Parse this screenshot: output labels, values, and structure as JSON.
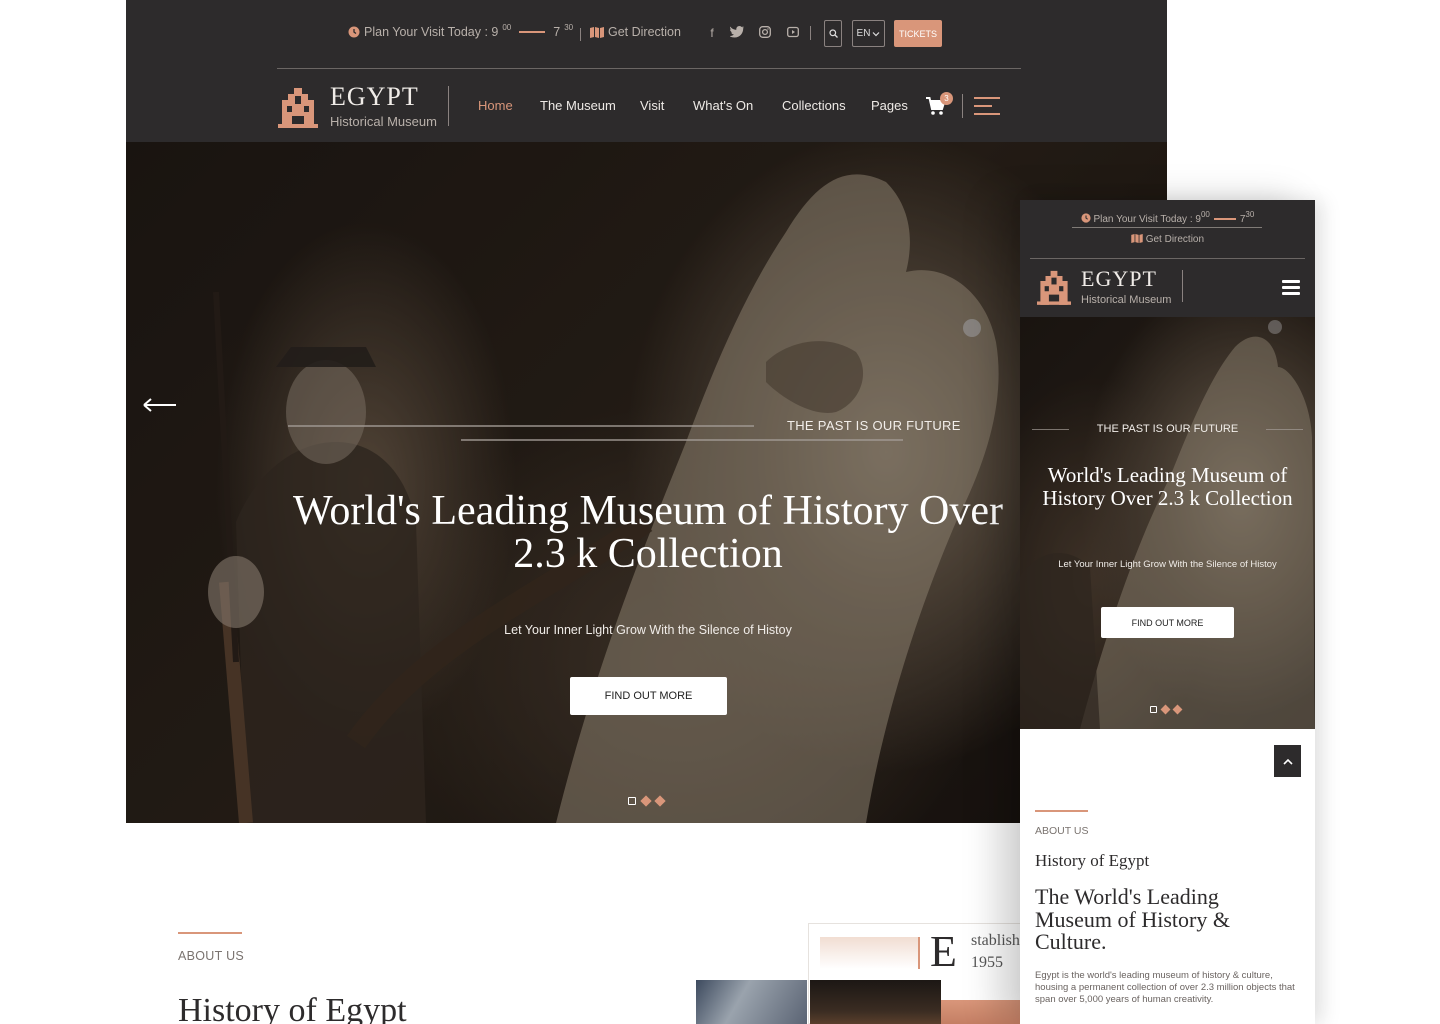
{
  "colors": {
    "accent": "#d9967a",
    "header_bg": "#2d2b2c",
    "white": "#ffffff"
  },
  "desktop": {
    "topbar": {
      "visit_label": "Plan Your Visit Today : 9",
      "open_sup": "00",
      "close_hour": "7",
      "close_sup": "30",
      "direction_label": "Get Direction",
      "social_icons": [
        "facebook-icon",
        "twitter-icon",
        "instagram-icon",
        "youtube-icon"
      ],
      "language": "EN",
      "tickets_label": "TICKETS"
    },
    "logo": {
      "title": "EGYPT",
      "subtitle": "Historical Museum"
    },
    "nav": {
      "items": [
        "Home",
        "The Museum",
        "Visit",
        "What's On",
        "Collections",
        "Pages"
      ],
      "active_index": 0,
      "cart_count": "3"
    },
    "hero": {
      "kicker": "THE PAST IS OUR FUTURE",
      "title": "World's Leading Museum of History Over 2.3 k Collection",
      "subtitle": "Let Your Inner Light Grow With the Silence of Histoy",
      "button": "FIND OUT MORE",
      "slide_count": 3,
      "active_slide": 1
    },
    "about": {
      "label": "ABOUT US",
      "title": "History of Egypt",
      "est_initial": "E",
      "est_line1": "stablish",
      "est_line2": "1955"
    }
  },
  "mobile": {
    "topbar": {
      "visit_label": "Plan Your Visit Today : 9",
      "open_sup": "00",
      "close_hour": "7",
      "close_sup": "30",
      "direction_label": "Get Direction"
    },
    "logo": {
      "title": "EGYPT",
      "subtitle": "Historical Museum"
    },
    "hero": {
      "kicker": "THE PAST IS OUR FUTURE",
      "title": "World's Leading Museum of History Over 2.3 k Collection",
      "subtitle": "Let Your Inner Light Grow With the Silence of Histoy",
      "button": "FIND OUT MORE",
      "slide_count": 3,
      "active_slide": 1
    },
    "about": {
      "label": "ABOUT US",
      "title": "History of Egypt",
      "heading": "The World's Leading Museum of History & Culture.",
      "text": "Egypt is the world's leading museum of history & culture, housing a permanent collection of over 2.3 million objects that span over 5,000 years of human creativity."
    }
  }
}
